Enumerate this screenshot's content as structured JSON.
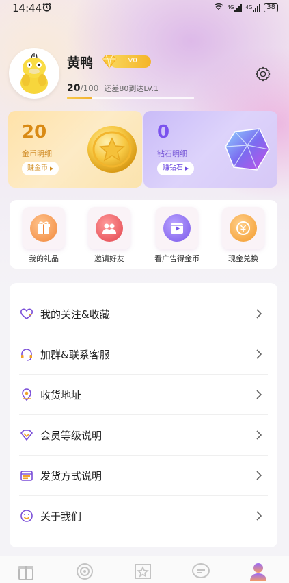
{
  "status_bar": {
    "time": "14:44",
    "network_1": "4G",
    "network_2": "4G",
    "battery": "38"
  },
  "profile": {
    "name": "黄鸭",
    "level": "LV0",
    "exp_current": "20",
    "exp_total": "/100",
    "exp_hint": "还差80到达LV.1",
    "exp_progress": 0.2
  },
  "gold_card": {
    "value": "20",
    "label": "金币明细",
    "button": "赚金币"
  },
  "diamond_card": {
    "value": "0",
    "label": "钻石明细",
    "button": "赚钻石"
  },
  "quick_actions": [
    {
      "label": "我的礼品",
      "icon": "gift-icon"
    },
    {
      "label": "邀请好友",
      "icon": "invite-friends-icon"
    },
    {
      "label": "看广告得金币",
      "icon": "watch-ad-icon"
    },
    {
      "label": "现金兑换",
      "icon": "cash-exchange-icon"
    }
  ],
  "menu": [
    {
      "label": "我的关注&收藏",
      "icon": "heart-icon"
    },
    {
      "label": "加群&联系客服",
      "icon": "headset-icon"
    },
    {
      "label": "收货地址",
      "icon": "location-icon"
    },
    {
      "label": "会员等级说明",
      "icon": "diamond-icon"
    },
    {
      "label": "发货方式说明",
      "icon": "box-icon"
    },
    {
      "label": "关于我们",
      "icon": "smile-icon"
    }
  ],
  "bottom_nav": [
    {
      "icon": "gift-box-icon",
      "active": false
    },
    {
      "icon": "target-icon",
      "active": false
    },
    {
      "icon": "star-ticket-icon",
      "active": false
    },
    {
      "icon": "chat-bubble-icon",
      "active": false
    },
    {
      "icon": "user-profile-icon",
      "active": true
    }
  ],
  "colors": {
    "gold": "#d98a14",
    "diamond": "#7b52ee",
    "accent_yellow": "#f4b428"
  }
}
